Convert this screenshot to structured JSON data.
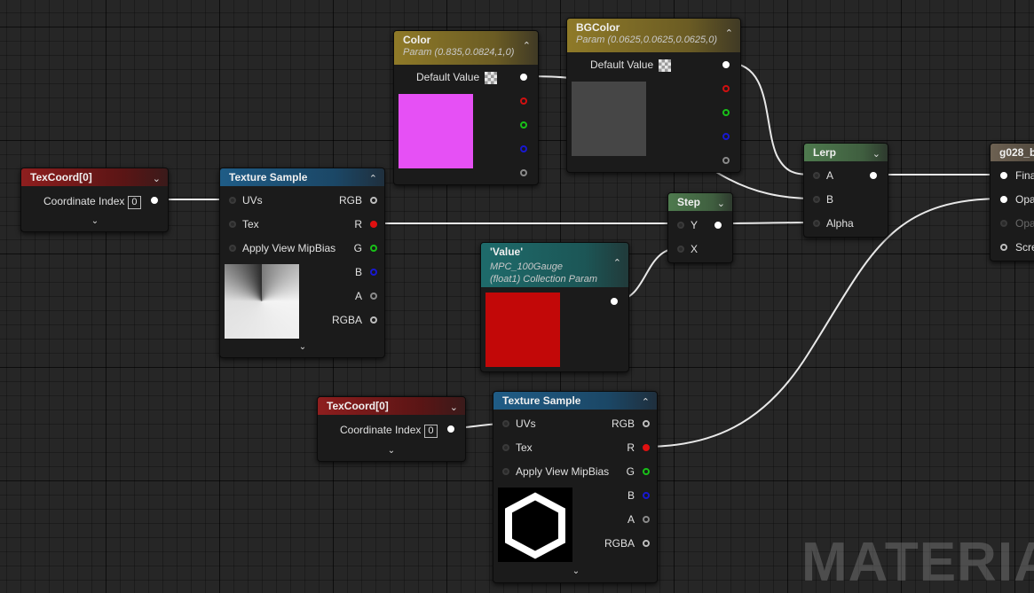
{
  "editor": {
    "watermark": "MATERIAL"
  },
  "nodes": {
    "texcoord1": {
      "title": "TexCoord[0]",
      "coordinate_label": "Coordinate Index",
      "coordinate_value": "0"
    },
    "texsample1": {
      "title": "Texture Sample",
      "inputs": [
        "UVs",
        "Tex",
        "Apply View MipBias"
      ],
      "outputs": [
        "RGB",
        "R",
        "G",
        "B",
        "A",
        "RGBA"
      ]
    },
    "color": {
      "title": "Color",
      "subtitle": "Param (0.835,0.0824,1,0)",
      "default_label": "Default Value",
      "swatch": "#e650f5"
    },
    "bgcolor": {
      "title": "BGColor",
      "subtitle": "Param (0.0625,0.0625,0.0625,0)",
      "default_label": "Default Value",
      "swatch": "#464646"
    },
    "value": {
      "title": "'Value'",
      "subtitle1": "MPC_100Gauge",
      "subtitle2": "(float1) Collection Param",
      "swatch": "#c20808"
    },
    "step": {
      "title": "Step",
      "inputs": [
        "Y",
        "X"
      ]
    },
    "lerp": {
      "title": "Lerp",
      "inputs": [
        "A",
        "B",
        "Alpha"
      ]
    },
    "output": {
      "title": "g028_b",
      "pins": [
        "Fina",
        "Opac",
        "Opa",
        "Scre"
      ]
    },
    "texcoord2": {
      "title": "TexCoord[0]",
      "coordinate_label": "Coordinate Index",
      "coordinate_value": "0"
    },
    "texsample2": {
      "title": "Texture Sample",
      "inputs": [
        "UVs",
        "Tex",
        "Apply View MipBias"
      ],
      "outputs": [
        "RGB",
        "R",
        "G",
        "B",
        "A",
        "RGBA"
      ]
    }
  }
}
